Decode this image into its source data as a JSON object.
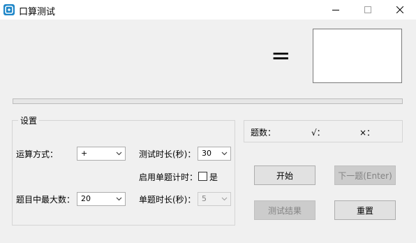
{
  "window": {
    "title": "口算测试"
  },
  "expression": {
    "equals": "="
  },
  "progress": {
    "fraction": 0
  },
  "settings": {
    "group_title": "设置",
    "operation": {
      "label": "运算方式：",
      "value": "+"
    },
    "max_number": {
      "label": "题目中最大数：",
      "value": "20"
    },
    "test_duration": {
      "label": "测试时长(秒)：",
      "value": "30"
    },
    "enable_per_question_timer": {
      "label": "启用单题计时：",
      "checkbox_label": "是",
      "checked": false
    },
    "per_question_duration": {
      "label": "单题时长(秒)：",
      "value": "5"
    }
  },
  "stats": {
    "count_label": "题数：",
    "correct_label": "√：",
    "wrong_label": "×："
  },
  "buttons": {
    "start": "开始",
    "next": "下一题(Enter)",
    "results": "测试结果",
    "reset": "重置"
  },
  "colors": {
    "progress_fill": "#06b025",
    "app_icon": "#1e86c8"
  }
}
